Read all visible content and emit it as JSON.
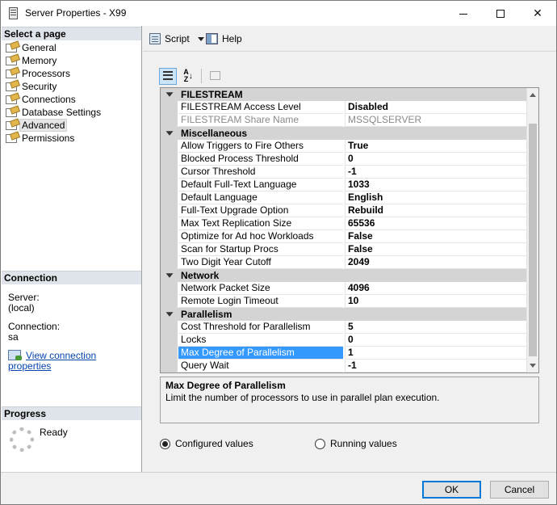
{
  "window": {
    "title": "Server Properties - X99"
  },
  "sidebar": {
    "select_header": "Select a page",
    "pages": [
      {
        "label": "General"
      },
      {
        "label": "Memory"
      },
      {
        "label": "Processors"
      },
      {
        "label": "Security"
      },
      {
        "label": "Connections"
      },
      {
        "label": "Database Settings"
      },
      {
        "label": "Advanced",
        "selected": true
      },
      {
        "label": "Permissions"
      }
    ],
    "connection_header": "Connection",
    "server_label": "Server:",
    "server_value": "(local)",
    "connection_label": "Connection:",
    "connection_value": "sa",
    "view_link": "View connection properties",
    "progress_header": "Progress",
    "progress_status": "Ready"
  },
  "toolbar": {
    "script_label": "Script",
    "help_label": "Help"
  },
  "grid": {
    "categories": [
      {
        "name": "FILESTREAM",
        "properties": [
          {
            "name": "FILESTREAM Access Level",
            "value": "Disabled"
          },
          {
            "name": "FILESTREAM Share Name",
            "value": "MSSQLSERVER",
            "readonly": true
          }
        ]
      },
      {
        "name": "Miscellaneous",
        "properties": [
          {
            "name": "Allow Triggers to Fire Others",
            "value": "True"
          },
          {
            "name": "Blocked Process Threshold",
            "value": "0"
          },
          {
            "name": "Cursor Threshold",
            "value": "-1"
          },
          {
            "name": "Default Full-Text Language",
            "value": "1033"
          },
          {
            "name": "Default Language",
            "value": "English"
          },
          {
            "name": "Full-Text Upgrade Option",
            "value": "Rebuild"
          },
          {
            "name": "Max Text Replication Size",
            "value": "65536"
          },
          {
            "name": "Optimize for Ad hoc Workloads",
            "value": "False"
          },
          {
            "name": "Scan for Startup Procs",
            "value": "False"
          },
          {
            "name": "Two Digit Year Cutoff",
            "value": "2049"
          }
        ]
      },
      {
        "name": "Network",
        "properties": [
          {
            "name": "Network Packet Size",
            "value": "4096"
          },
          {
            "name": "Remote Login Timeout",
            "value": "10"
          }
        ]
      },
      {
        "name": "Parallelism",
        "properties": [
          {
            "name": "Cost Threshold for Parallelism",
            "value": "5"
          },
          {
            "name": "Locks",
            "value": "0"
          },
          {
            "name": "Max Degree of Parallelism",
            "value": "1",
            "selected": true
          },
          {
            "name": "Query Wait",
            "value": "-1"
          }
        ]
      }
    ]
  },
  "description": {
    "title": "Max Degree of Parallelism",
    "text": "Limit the number of processors to use in parallel plan execution."
  },
  "options": {
    "configured_label": "Configured values",
    "running_label": "Running values",
    "selected": "configured"
  },
  "buttons": {
    "ok_label": "OK",
    "cancel_label": "Cancel"
  },
  "colors": {
    "selection": "#3399ff",
    "category_bg": "#d4d4d4",
    "link": "#0645ad"
  }
}
